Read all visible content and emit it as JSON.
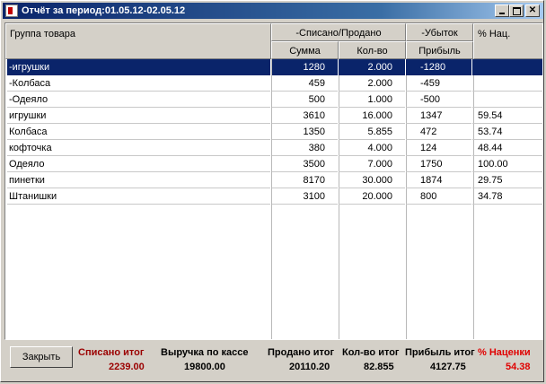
{
  "window": {
    "title": "Отчёт за период:01.05.12-02.05.12"
  },
  "header": {
    "group_label": "Группа товара",
    "written_off_sold": "-Списано/Продано",
    "sum_label": "Сумма",
    "qty_label": "Кол-во",
    "loss_label": "-Убыток",
    "profit_label": "Прибыль",
    "markup_label": "% Нац."
  },
  "rows": [
    {
      "name": "-игрушки",
      "sum": "1280",
      "qty": "2.000",
      "profit": "-1280",
      "markup": ""
    },
    {
      "name": "-Колбаса",
      "sum": "459",
      "qty": "2.000",
      "profit": "-459",
      "markup": ""
    },
    {
      "name": "-Одеяло",
      "sum": "500",
      "qty": "1.000",
      "profit": "-500",
      "markup": ""
    },
    {
      "name": "игрушки",
      "sum": "3610",
      "qty": "16.000",
      "profit": "1347",
      "markup": "59.54"
    },
    {
      "name": "Колбаса",
      "sum": "1350",
      "qty": "5.855",
      "profit": "472",
      "markup": "53.74"
    },
    {
      "name": "кофточка",
      "sum": "380",
      "qty": "4.000",
      "profit": "124",
      "markup": "48.44"
    },
    {
      "name": "Одеяло",
      "sum": "3500",
      "qty": "7.000",
      "profit": "1750",
      "markup": "100.00"
    },
    {
      "name": "пинетки",
      "sum": "8170",
      "qty": "30.000",
      "profit": "1874",
      "markup": "29.75"
    },
    {
      "name": "Штанишки",
      "sum": "3100",
      "qty": "20.000",
      "profit": "800",
      "markup": "34.78"
    }
  ],
  "footer": {
    "close_label": "Закрыть",
    "written_off_total_label": "Списано итог",
    "written_off_total": "2239.00",
    "cash_revenue_label": "Выручка по кассе",
    "cash_revenue": "19800.00",
    "sold_total_label": "Продано итог",
    "sold_total": "20110.20",
    "qty_total_label": "Кол-во итог",
    "qty_total": "82.855",
    "profit_total_label": "Прибыль итог",
    "profit_total": "4127.75",
    "markup_total_label": "% Наценки",
    "markup_total": "54.38"
  },
  "colors": {
    "selection": "#0a246a",
    "total_red": "#9b0000",
    "markup_red": "#e00000"
  }
}
